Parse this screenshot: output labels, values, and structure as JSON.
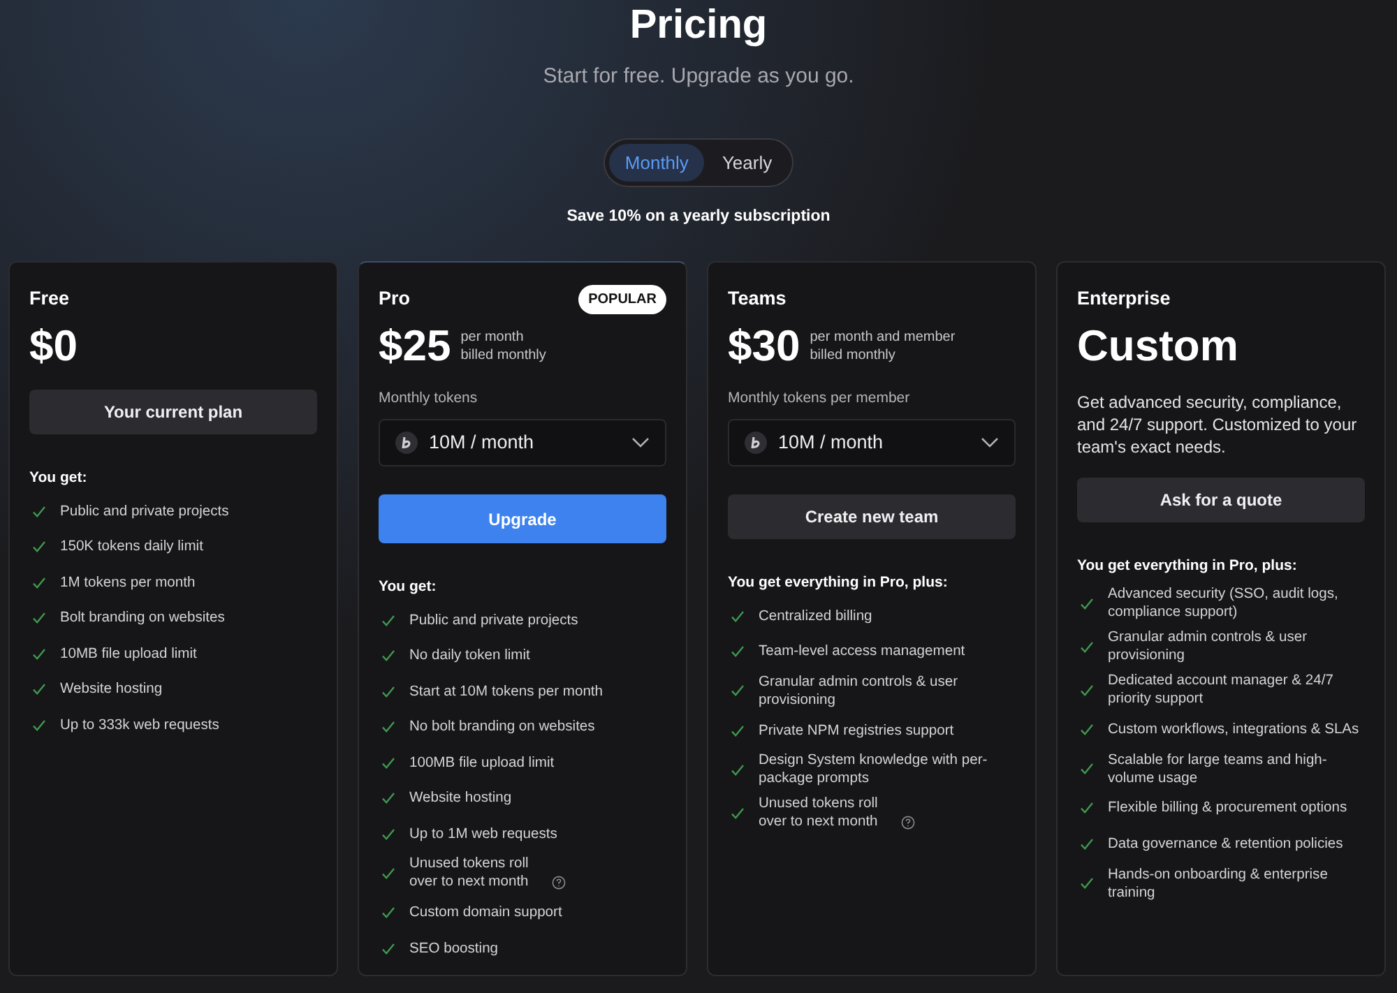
{
  "header": {
    "title": "Pricing",
    "subtitle": "Start for free. Upgrade as you go."
  },
  "billing_toggle": [
    {
      "label": "Monthly",
      "selected": true
    },
    {
      "label": "Yearly",
      "selected": false
    }
  ],
  "savings_note": "Save 10% on a yearly subscription",
  "plans": [
    {
      "name": "Free",
      "price": "$0",
      "button": {
        "label": "Your current plan",
        "kind": "secondary"
      },
      "features_heading": "You get:",
      "features": [
        {
          "text": "Public and private projects"
        },
        {
          "text": "150K tokens daily limit"
        },
        {
          "text": "1M tokens per month"
        },
        {
          "text": "Bolt branding on websites"
        },
        {
          "text": "10MB file upload limit"
        },
        {
          "text": "Website hosting"
        },
        {
          "text": "Up to 333k web requests"
        }
      ]
    },
    {
      "name": "Pro",
      "badge": "POPULAR",
      "price": "$25",
      "price_note": [
        "per month",
        "billed monthly"
      ],
      "token_select": {
        "label": "Monthly tokens",
        "value": "10M / month"
      },
      "button": {
        "label": "Upgrade",
        "kind": "primary"
      },
      "features_heading": "You get:",
      "features": [
        {
          "text": "Public and private projects"
        },
        {
          "text": "No daily token limit"
        },
        {
          "text": "Start at 10M tokens per month"
        },
        {
          "text": "No bolt branding on websites"
        },
        {
          "text": "100MB file upload limit"
        },
        {
          "text": "Website hosting"
        },
        {
          "text": "Up to 1M web requests"
        },
        {
          "text": "Unused tokens roll over to next month",
          "help": true
        },
        {
          "text": "Custom domain support"
        },
        {
          "text": "SEO boosting"
        }
      ]
    },
    {
      "name": "Teams",
      "price": "$30",
      "price_note": [
        "per month and member",
        "billed monthly"
      ],
      "token_select": {
        "label": "Monthly tokens per member",
        "value": "10M / month"
      },
      "button": {
        "label": "Create new team",
        "kind": "secondary"
      },
      "features_heading": "You get everything in Pro, plus:",
      "features": [
        {
          "text": "Centralized billing"
        },
        {
          "text": "Team-level access management"
        },
        {
          "text": "Granular admin controls & user provisioning"
        },
        {
          "text": "Private NPM registries support"
        },
        {
          "text": "Design System knowledge with per-package prompts"
        },
        {
          "text": "Unused tokens roll over to next month",
          "help": true
        }
      ]
    },
    {
      "name": "Enterprise",
      "price": "Custom",
      "description": "Get advanced security, compliance, and 24/7 support. Customized to your team's exact needs.",
      "button": {
        "label": "Ask for a quote",
        "kind": "secondary"
      },
      "features_heading": "You get everything in Pro, plus:",
      "features": [
        {
          "text": "Advanced security (SSO, audit logs, compliance support)"
        },
        {
          "text": "Granular admin controls & user provisioning"
        },
        {
          "text": "Dedicated account manager & 24/7 priority support"
        },
        {
          "text": "Custom workflows, integrations & SLAs"
        },
        {
          "text": "Scalable for large teams and high-volume usage"
        },
        {
          "text": "Flexible billing & procurement options"
        },
        {
          "text": "Data governance & retention policies"
        },
        {
          "text": "Hands-on onboarding & enterprise training"
        }
      ]
    }
  ]
}
